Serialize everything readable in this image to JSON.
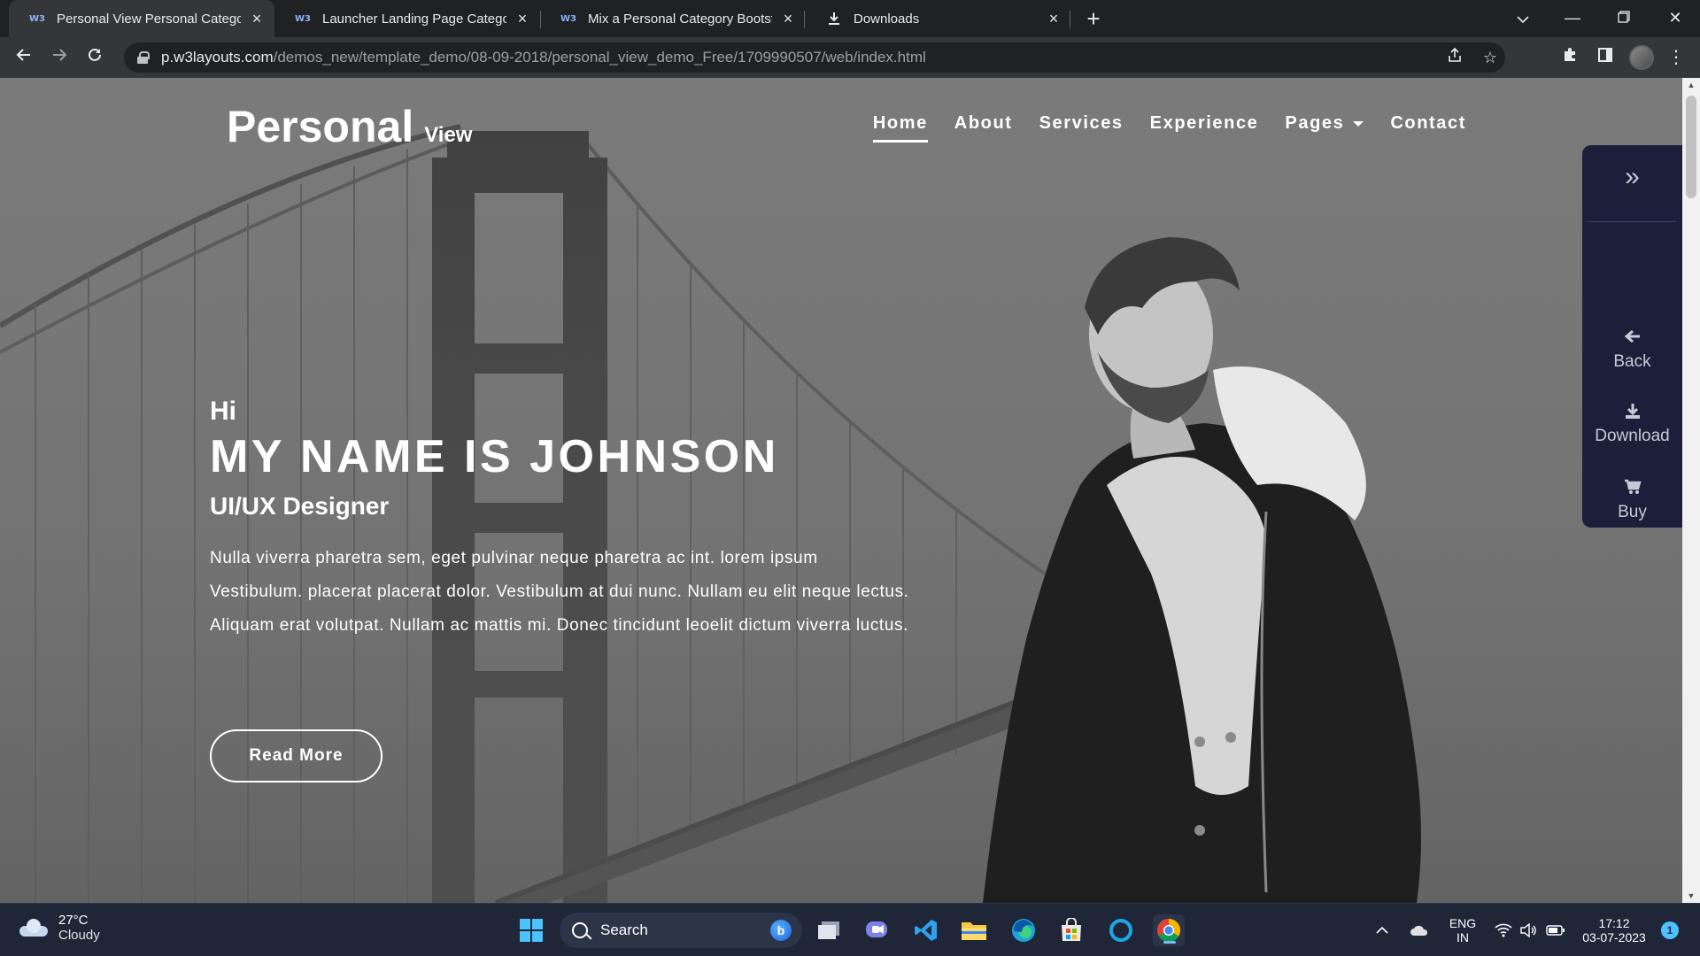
{
  "browser": {
    "tabs": [
      {
        "title": "Personal View Personal Category",
        "favicon": "W3",
        "active": true
      },
      {
        "title": "Launcher Landing Page Category",
        "favicon": "W3",
        "active": false
      },
      {
        "title": "Mix a Personal Category Bootstra",
        "favicon": "W3",
        "active": false
      },
      {
        "title": "Downloads",
        "favicon": "download-icon",
        "active": false
      }
    ],
    "url_domain": "p.w3layouts.com",
    "url_path": "/demos_new/template_demo/08-09-2018/personal_view_demo_Free/1709990507/web/index.html"
  },
  "site": {
    "brand_main": "Personal",
    "brand_sub": "View",
    "nav": [
      {
        "label": "Home",
        "active": true
      },
      {
        "label": "About"
      },
      {
        "label": "Services"
      },
      {
        "label": "Experience"
      },
      {
        "label": "Pages",
        "dropdown": true
      },
      {
        "label": "Contact"
      }
    ],
    "hero": {
      "greeting": "Hi",
      "name": "MY NAME IS JOHNSON",
      "role": "UI/UX Designer",
      "description": "Nulla viverra pharetra sem, eget pulvinar neque pharetra ac int. lorem ipsum Vestibulum. placerat placerat dolor. Vestibulum at dui nunc. Nullam eu elit neque lectus. Aliquam erat volutpat. Nullam ac mattis mi. Donec tincidunt leoelit dictum viverra luctus.",
      "button": "Read More"
    },
    "side_panel": {
      "items": [
        {
          "label": "Back",
          "icon": "arrow-left-icon"
        },
        {
          "label": "Download",
          "icon": "download-icon"
        },
        {
          "label": "Buy",
          "icon": "cart-icon"
        }
      ]
    }
  },
  "taskbar": {
    "weather_temp": "27°C",
    "weather_desc": "Cloudy",
    "search_label": "Search",
    "lang_1": "ENG",
    "lang_2": "IN",
    "time": "17:12",
    "date": "03-07-2023",
    "notification_count": "1"
  },
  "colors": {
    "side_panel_bg": "#1b1f3a",
    "taskbar_bg": "#1e2638",
    "chrome_tab_bg": "#35363a"
  }
}
